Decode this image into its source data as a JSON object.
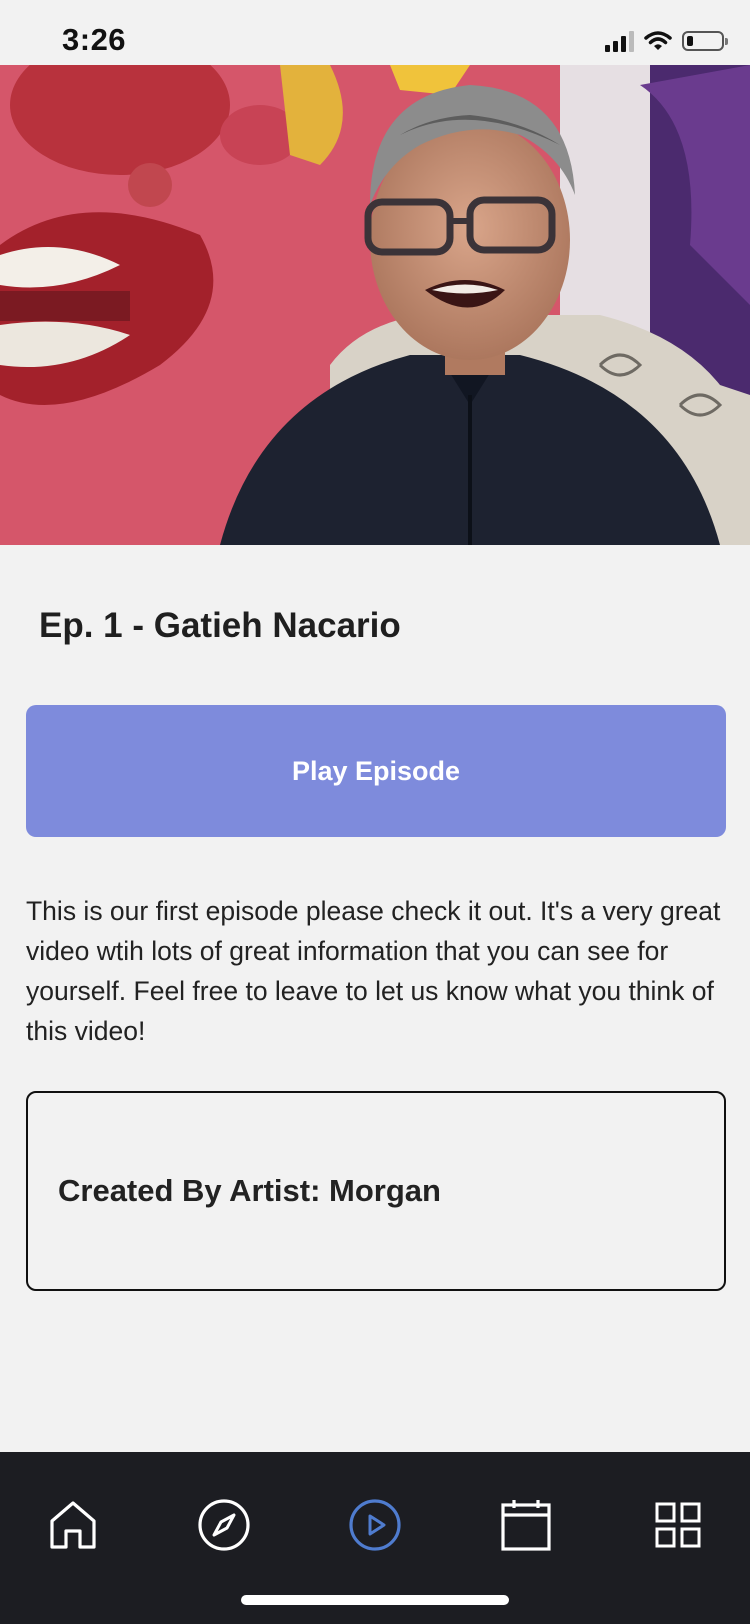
{
  "status_bar": {
    "time": "3:26",
    "battery_level": 0.2
  },
  "episode": {
    "title": "Ep. 1 - Gatieh Nacario",
    "play_label": "Play Episode",
    "description": "This is our first episode please check it out. It's a very great video wtih lots of great information that you can see for yourself. Feel free to leave to let us know what you think of this video!",
    "artist_credit": "Created By Artist: Morgan"
  },
  "colors": {
    "accent": "#7e8bdc",
    "tab_active": "#4f7ccf",
    "tab_inactive": "#ffffff",
    "tabbar_bg": "#1c1d22"
  },
  "tabs": [
    {
      "icon": "home-icon",
      "active": false
    },
    {
      "icon": "compass-icon",
      "active": false
    },
    {
      "icon": "play-circle-icon",
      "active": true
    },
    {
      "icon": "calendar-icon",
      "active": false
    },
    {
      "icon": "grid-icon",
      "active": false
    }
  ]
}
